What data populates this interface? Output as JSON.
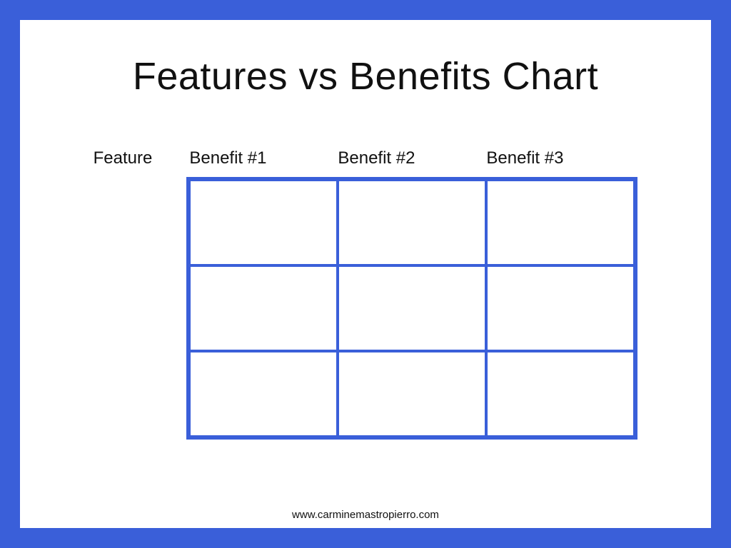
{
  "title": "Features vs Benefits Chart",
  "feature_label": "Feature",
  "columns": {
    "col1": "Benefit #1",
    "col2": "Benefit #2",
    "col3": "Benefit #3"
  },
  "grid": {
    "rows": 3,
    "cols": 3,
    "cells": [
      "",
      "",
      "",
      "",
      "",
      "",
      "",
      "",
      ""
    ]
  },
  "footer": "www.carminemastropierro.com",
  "colors": {
    "accent": "#3a5fd9"
  },
  "chart_data": {
    "type": "table",
    "title": "Features vs Benefits Chart",
    "columns": [
      "Feature",
      "Benefit #1",
      "Benefit #2",
      "Benefit #3"
    ],
    "rows": [
      [
        "",
        "",
        "",
        ""
      ],
      [
        "",
        "",
        "",
        ""
      ],
      [
        "",
        "",
        "",
        ""
      ]
    ]
  }
}
